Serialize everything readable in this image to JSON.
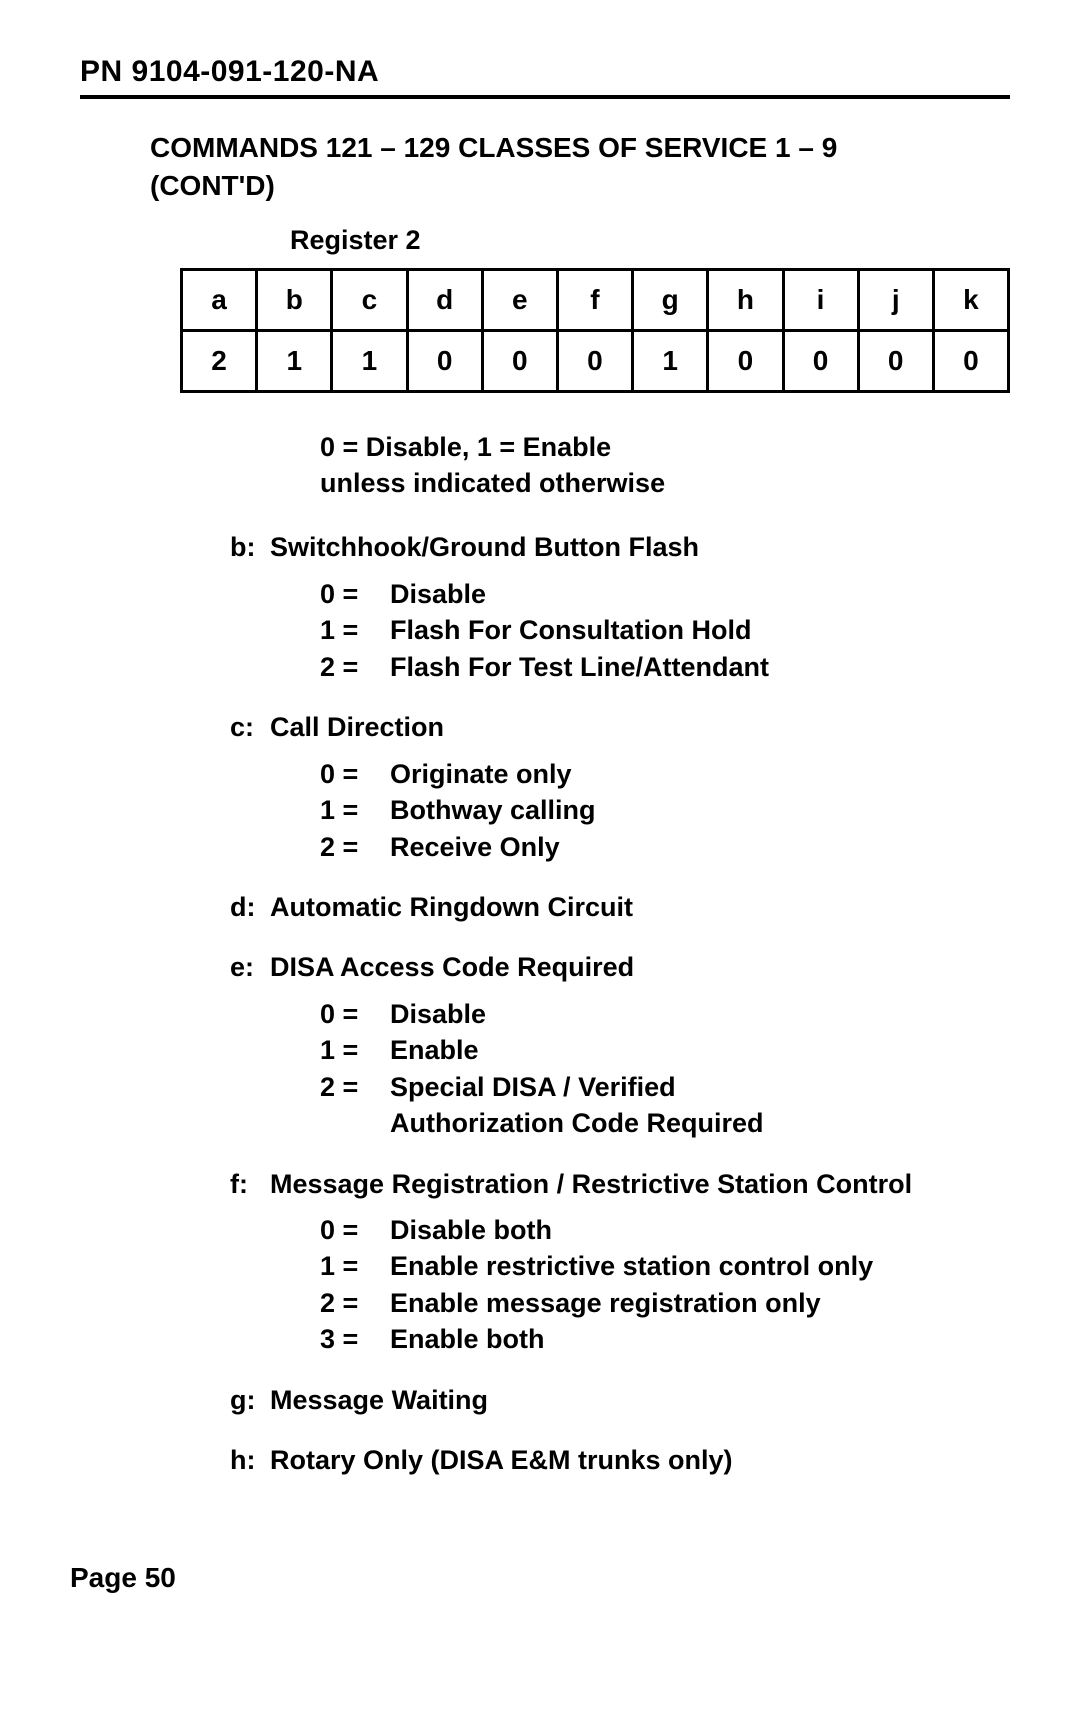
{
  "doc_id": "PN 9104-091-120-NA",
  "section_title_line1": "COMMANDS 121 – 129 CLASSES OF SERVICE 1 – 9",
  "section_title_line2": "(CONT'D)",
  "register_label": "Register 2",
  "register_table": {
    "headers": [
      "a",
      "b",
      "c",
      "d",
      "e",
      "f",
      "g",
      "h",
      "i",
      "j",
      "k"
    ],
    "values": [
      "2",
      "1",
      "1",
      "0",
      "0",
      "0",
      "1",
      "0",
      "0",
      "0",
      "0"
    ]
  },
  "legend_line1": "0 = Disable, 1 = Enable",
  "legend_line2": "unless indicated otherwise",
  "entries": {
    "b": {
      "key": "b:",
      "label": "Switchhook/Ground Button Flash",
      "opts": [
        {
          "lead": "0 =",
          "text": "Disable"
        },
        {
          "lead": "1 =",
          "text": "Flash For Consultation Hold"
        },
        {
          "lead": "2 =",
          "text": "Flash For Test Line/Attendant"
        }
      ]
    },
    "c": {
      "key": "c:",
      "label": "Call Direction",
      "opts": [
        {
          "lead": "0 =",
          "text": "Originate only"
        },
        {
          "lead": "1 =",
          "text": "Bothway calling"
        },
        {
          "lead": "2 =",
          "text": "Receive Only"
        }
      ]
    },
    "d": {
      "key": "d:",
      "label": "Automatic Ringdown Circuit"
    },
    "e": {
      "key": "e:",
      "label": "DISA Access Code Required",
      "opts": [
        {
          "lead": "0 =",
          "text": "Disable"
        },
        {
          "lead": "1 =",
          "text": "Enable"
        },
        {
          "lead": "2 =",
          "text": "Special DISA / Verified",
          "cont": "Authorization Code Required"
        }
      ]
    },
    "f": {
      "key": "f:",
      "label": "Message Registration / Restrictive Station Control",
      "opts": [
        {
          "lead": "0 =",
          "text": "Disable both"
        },
        {
          "lead": "1 =",
          "text": "Enable restrictive station control only"
        },
        {
          "lead": "2 =",
          "text": "Enable message registration only"
        },
        {
          "lead": "3 =",
          "text": "Enable both"
        }
      ]
    },
    "g": {
      "key": "g:",
      "label": "Message Waiting"
    },
    "h": {
      "key": "h:",
      "label": "Rotary Only (DISA E&M trunks only)"
    }
  },
  "page_footer": "Page 50"
}
